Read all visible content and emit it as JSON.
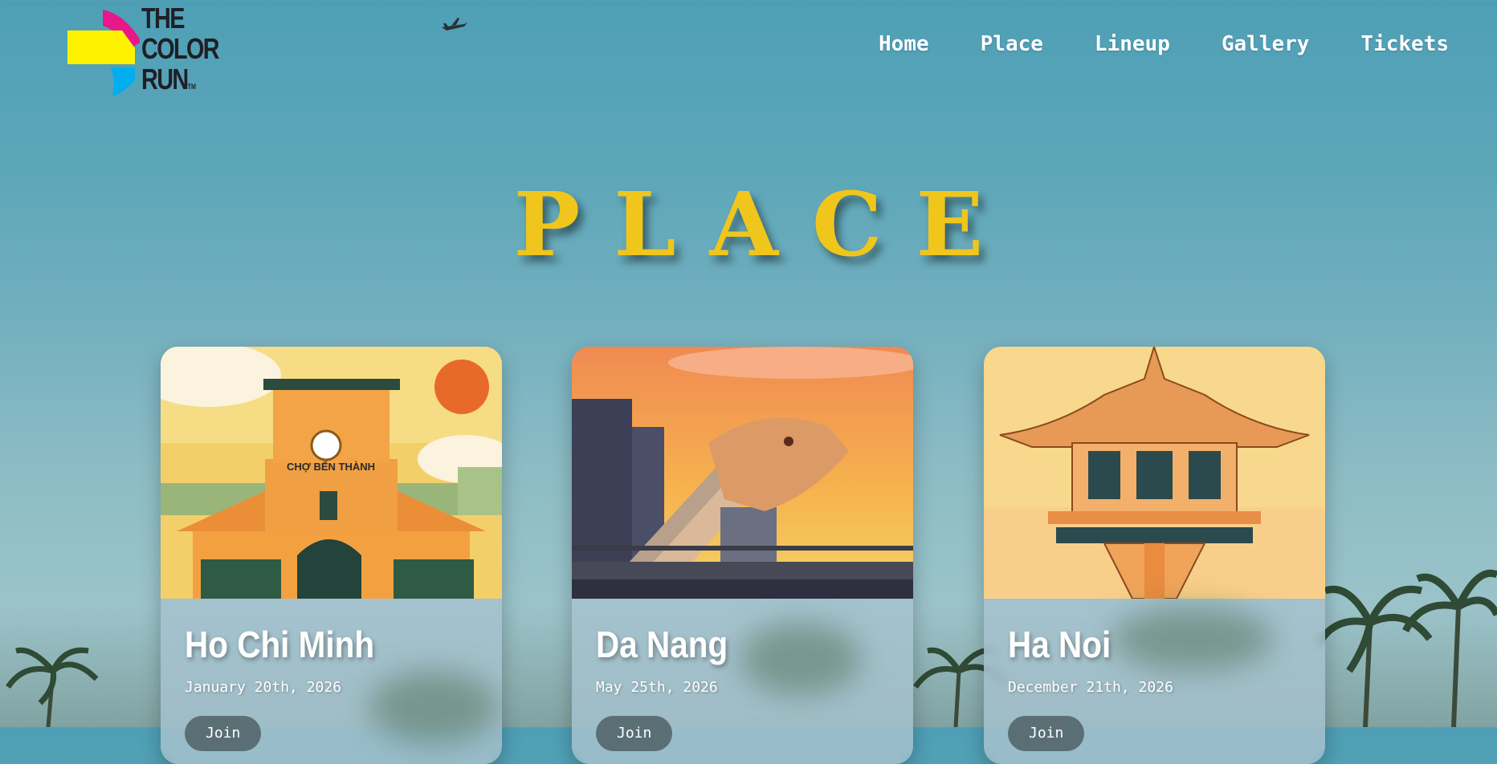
{
  "brand": {
    "logo_lines": [
      "THE",
      "COLOR",
      "RUN"
    ],
    "trademark": "TM"
  },
  "nav": {
    "items": [
      {
        "label": "Home"
      },
      {
        "label": "Place"
      },
      {
        "label": "Lineup"
      },
      {
        "label": "Gallery"
      },
      {
        "label": "Tickets"
      }
    ]
  },
  "section": {
    "title": "PLACE"
  },
  "cards": [
    {
      "title": "Ho Chi Minh",
      "date": "January 20th, 2026",
      "button": "Join",
      "image_sign": "CHỢ BẾN THÀNH",
      "image": "ben-thanh-market-illustration"
    },
    {
      "title": "Da Nang",
      "date": "May 25th, 2026",
      "button": "Join",
      "image": "dragon-bridge-illustration"
    },
    {
      "title": "Ha Noi",
      "date": "December 21th, 2026",
      "button": "Join",
      "image": "one-pillar-pagoda-illustration"
    }
  ],
  "colors": {
    "heading": "#f0c61c",
    "nav_text": "#ffffff",
    "sky_top": "#4e9fb6",
    "logo_magenta": "#e8178a",
    "logo_yellow": "#fff200",
    "logo_cyan": "#00aeef"
  }
}
